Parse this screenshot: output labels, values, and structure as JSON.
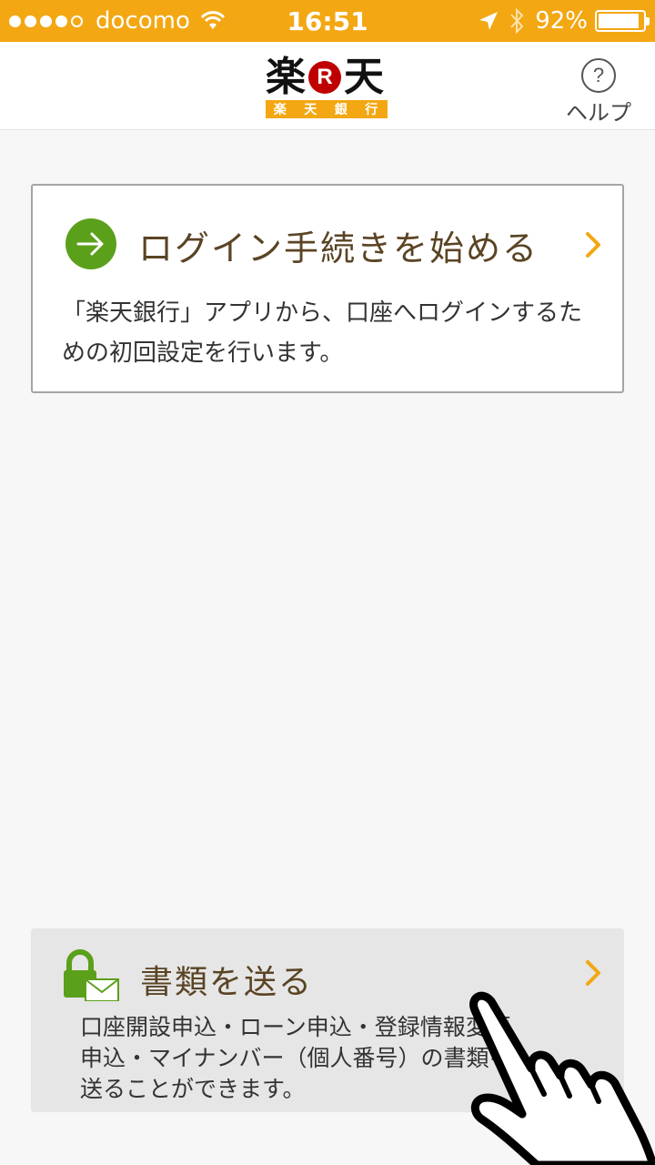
{
  "status_bar": {
    "carrier": "docomo",
    "time": "16:51",
    "battery_percent": "92%",
    "battery_level": 0.92,
    "signal_bars_filled": 4,
    "signal_bars_total": 5
  },
  "header": {
    "logo_main_left": "楽",
    "logo_r": "R",
    "logo_main_right": "天",
    "logo_sub": [
      "楽",
      "天",
      "銀",
      "行"
    ],
    "help_symbol": "?",
    "help_label": "ヘルプ"
  },
  "login_card": {
    "title": "ログイン手続きを始める",
    "description": "「楽天銀行」アプリから、口座へログインするための初回設定を行います。"
  },
  "docs_card": {
    "title": "書類を送る",
    "description_line1": "口座開設申込・ローン申込・登録情報変更",
    "description_line2": "申込・マイナンバー（個人番号）の書類を",
    "description_line3": "送ることができます。"
  },
  "colors": {
    "status_bar": "#f3a712",
    "accent_green": "#5ba01b",
    "chevron": "#f3a712",
    "title_brown": "#5a4424",
    "logo_red": "#bf0000"
  },
  "icons": {
    "login": "arrow-right-circle-icon",
    "docs": "lock-mail-icon",
    "help": "question-circle-icon"
  }
}
